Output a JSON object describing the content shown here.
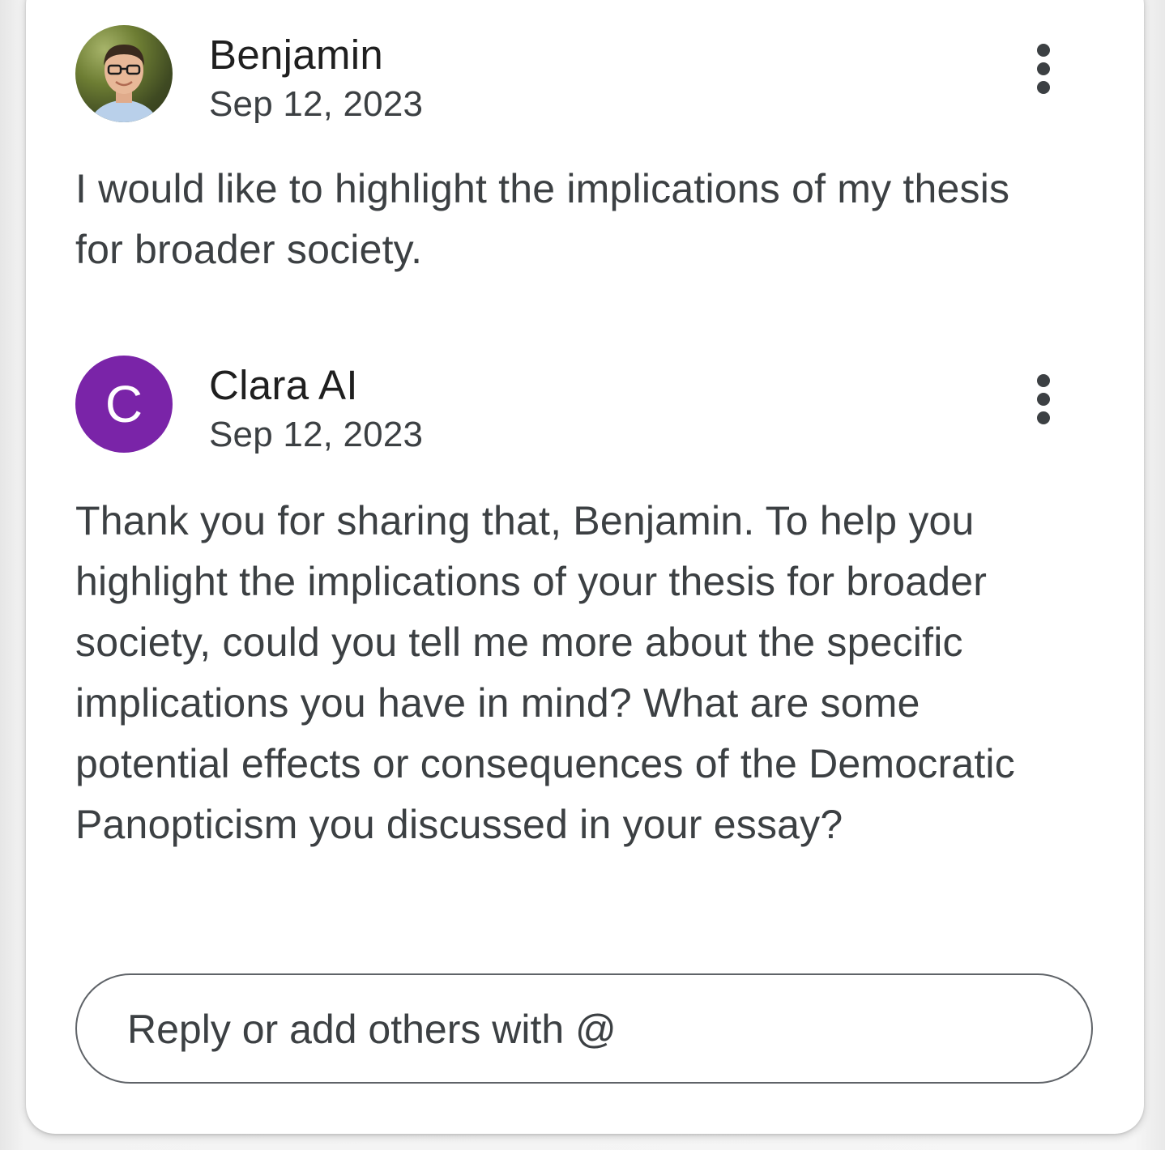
{
  "comments": [
    {
      "author": "Benjamin",
      "date": "Sep 12, 2023",
      "avatar": "photo",
      "text": "I would like to highlight the implications of my thesis for broader society."
    },
    {
      "author": "Clara AI",
      "date": "Sep 12, 2023",
      "avatar_letter": "C",
      "avatar_color": "#7a24a8",
      "text": "Thank you for sharing that, Benjamin. To help you highlight the implications of your thesis for broader society, could you tell me more about the specific implications you have in mind? What are some potential effects or consequences of the Democratic Panopticism you discussed in your essay?"
    }
  ],
  "reply": {
    "placeholder": "Reply or add others with @"
  },
  "icons": {
    "more": "more-vert-icon"
  }
}
